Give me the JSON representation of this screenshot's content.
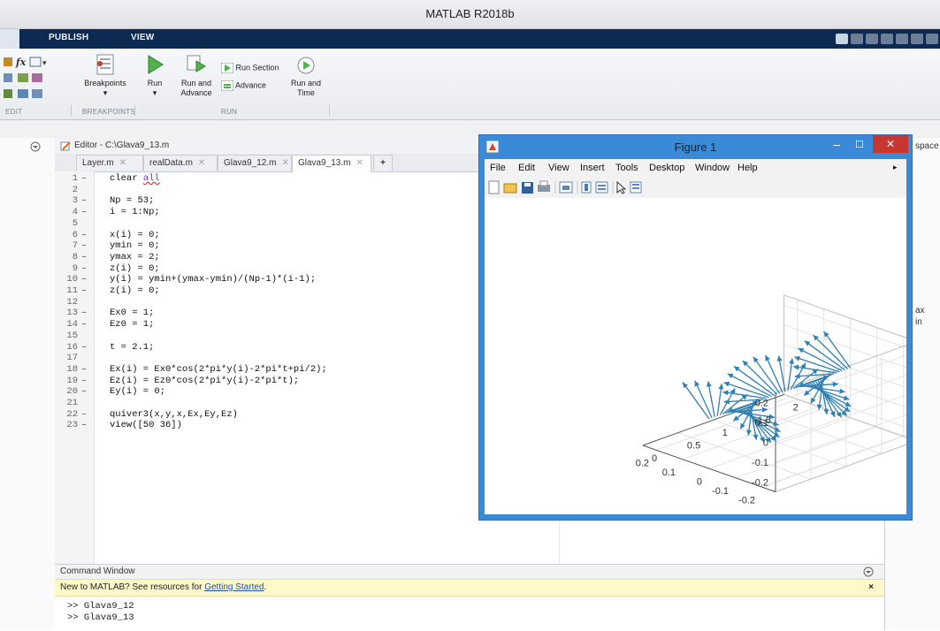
{
  "window": {
    "title": "MATLAB R2018b"
  },
  "ribbon": {
    "tabs": [
      "PUBLISH",
      "VIEW"
    ],
    "buttons": {
      "breakpoints": "Breakpoints",
      "run": "Run",
      "run_and_advance": "Run and Advance",
      "run_section": "Run Section",
      "advance": "Advance",
      "run_and_time": "Run and Time"
    },
    "groups": {
      "edit": "EDIT",
      "breakpoints": "BREAKPOINTS",
      "run": "RUN"
    }
  },
  "editor": {
    "title": "Editor - C:\\Glava9_13.m",
    "tabs": [
      "Layer.m",
      "realData.m",
      "Glava9_12.m",
      "Glava9_13.m"
    ],
    "active_tab": 3,
    "lines": [
      {
        "n": "1",
        "code": "clear all",
        "dash": true
      },
      {
        "n": "2",
        "code": "",
        "dash": false
      },
      {
        "n": "3",
        "code": "Np = 53;",
        "dash": true
      },
      {
        "n": "4",
        "code": "i = 1:Np;",
        "dash": true
      },
      {
        "n": "5",
        "code": "",
        "dash": false
      },
      {
        "n": "6",
        "code": "x(i) = 0;",
        "dash": true
      },
      {
        "n": "7",
        "code": "ymin = 0;",
        "dash": true
      },
      {
        "n": "8",
        "code": "ymax = 2;",
        "dash": true
      },
      {
        "n": "9",
        "code": "z(i) = 0;",
        "dash": true
      },
      {
        "n": "10",
        "code": "y(i) = ymin+(ymax-ymin)/(Np-1)*(i-1);",
        "dash": true
      },
      {
        "n": "11",
        "code": "z(i) = 0;",
        "dash": true
      },
      {
        "n": "12",
        "code": "",
        "dash": false
      },
      {
        "n": "13",
        "code": "Ex0 = 1;",
        "dash": true
      },
      {
        "n": "14",
        "code": "Ez0 = 1;",
        "dash": true
      },
      {
        "n": "15",
        "code": "",
        "dash": false
      },
      {
        "n": "16",
        "code": "t = 2.1;",
        "dash": true
      },
      {
        "n": "17",
        "code": "",
        "dash": false
      },
      {
        "n": "18",
        "code": "Ex(i) = Ex0*cos(2*pi*y(i)-2*pi*t+pi/2);",
        "dash": true
      },
      {
        "n": "19",
        "code": "Ez(i) = Ez0*cos(2*pi*y(i)-2*pi*t);",
        "dash": true
      },
      {
        "n": "20",
        "code": "Ey(i) = 0;",
        "dash": true
      },
      {
        "n": "21",
        "code": "",
        "dash": false
      },
      {
        "n": "22",
        "code": "quiver3(x,y,x,Ex,Ey,Ez)",
        "dash": true
      },
      {
        "n": "23",
        "code": "view([50 36])",
        "dash": true
      }
    ]
  },
  "workspace": {
    "title_fragment": "space",
    "var1": "ax",
    "var2": "in"
  },
  "command_window": {
    "title": "Command Window",
    "info_prefix": "New to MATLAB? See resources for ",
    "info_link": "Getting Started",
    "info_suffix": ".",
    "history": [
      ">> Glava9_12",
      ">> Glava9_13"
    ]
  },
  "figure": {
    "title": "Figure 1",
    "menu": [
      "File",
      "Edit",
      "View",
      "Insert",
      "Tools",
      "Desktop",
      "Window",
      "Help"
    ],
    "arrow_color": "#2e7fb3"
  },
  "chart_data": {
    "type": "quiver3",
    "title": "",
    "z_ticks": [
      "0.2",
      "0.1",
      "0",
      "-0.1",
      "-0.2"
    ],
    "x_ticks": [
      "-0.2",
      "-0.1",
      "0",
      "0.1",
      "0.2"
    ],
    "y_ticks": [
      "0",
      "0.5",
      "1",
      "1.5",
      "2"
    ],
    "zlim": [
      -0.25,
      0.25
    ],
    "xlim": [
      -0.25,
      0.25
    ],
    "ylim": [
      0,
      2
    ],
    "view": [
      50,
      36
    ],
    "grid": true,
    "Np": 53,
    "t": 2.1
  }
}
